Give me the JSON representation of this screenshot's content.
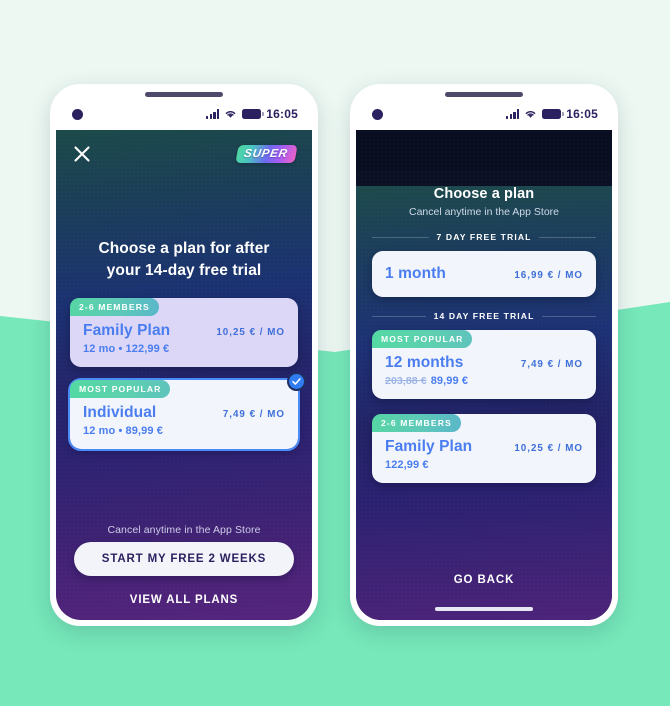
{
  "background": {
    "top_color": "#edf8f2",
    "mint_color": "#76e8b9"
  },
  "phone_left": {
    "status_bar": {
      "time": "16:05",
      "signal_icon": "signal-bars-icon",
      "wifi_icon": "wifi-icon",
      "battery_icon": "battery-icon",
      "camera_icon": "camera-dot-icon"
    },
    "topbar": {
      "close_icon": "close-x-icon",
      "logo_text": "SUPER"
    },
    "headline_line1": "Choose a plan for after",
    "headline_line2": "your 14-day free trial",
    "cards": [
      {
        "tag": "2-6 MEMBERS",
        "name": "Family Plan",
        "price": "10,25 € / MO",
        "sub": "12 mo • 122,99 €",
        "selected": false,
        "style": "violet"
      },
      {
        "tag": "MOST POPULAR",
        "name": "Individual",
        "price": "7,49 € / MO",
        "sub": "12 mo • 89,99 €",
        "selected": true,
        "style": "white",
        "check_icon": "check-circle-icon"
      }
    ],
    "footnote": "Cancel anytime in the App Store",
    "cta_label": "START MY FREE 2 WEEKS",
    "link_label": "VIEW ALL PLANS"
  },
  "phone_right": {
    "status_bar": {
      "time": "16:05",
      "signal_icon": "signal-bars-icon",
      "wifi_icon": "wifi-icon",
      "battery_icon": "battery-icon",
      "camera_icon": "camera-dot-icon"
    },
    "title": "Choose a plan",
    "subtitle": "Cancel anytime in the App Store",
    "section_1_label": "7 DAY FREE TRIAL",
    "section_2_label": "14 DAY FREE TRIAL",
    "cards": [
      {
        "tag": "",
        "name": "1 month",
        "price": "16,99 € / MO",
        "sub": "",
        "old_price": "",
        "style": "white"
      },
      {
        "tag": "MOST POPULAR",
        "name": "12 months",
        "price": "7,49 € / MO",
        "sub": "89,99 €",
        "old_price": "203,88 €",
        "style": "white"
      },
      {
        "tag": "2-6 MEMBERS",
        "name": "Family Plan",
        "price": "10,25 € / MO",
        "sub": "122,99 €",
        "old_price": "",
        "style": "white"
      }
    ],
    "go_back_label": "GO BACK"
  }
}
